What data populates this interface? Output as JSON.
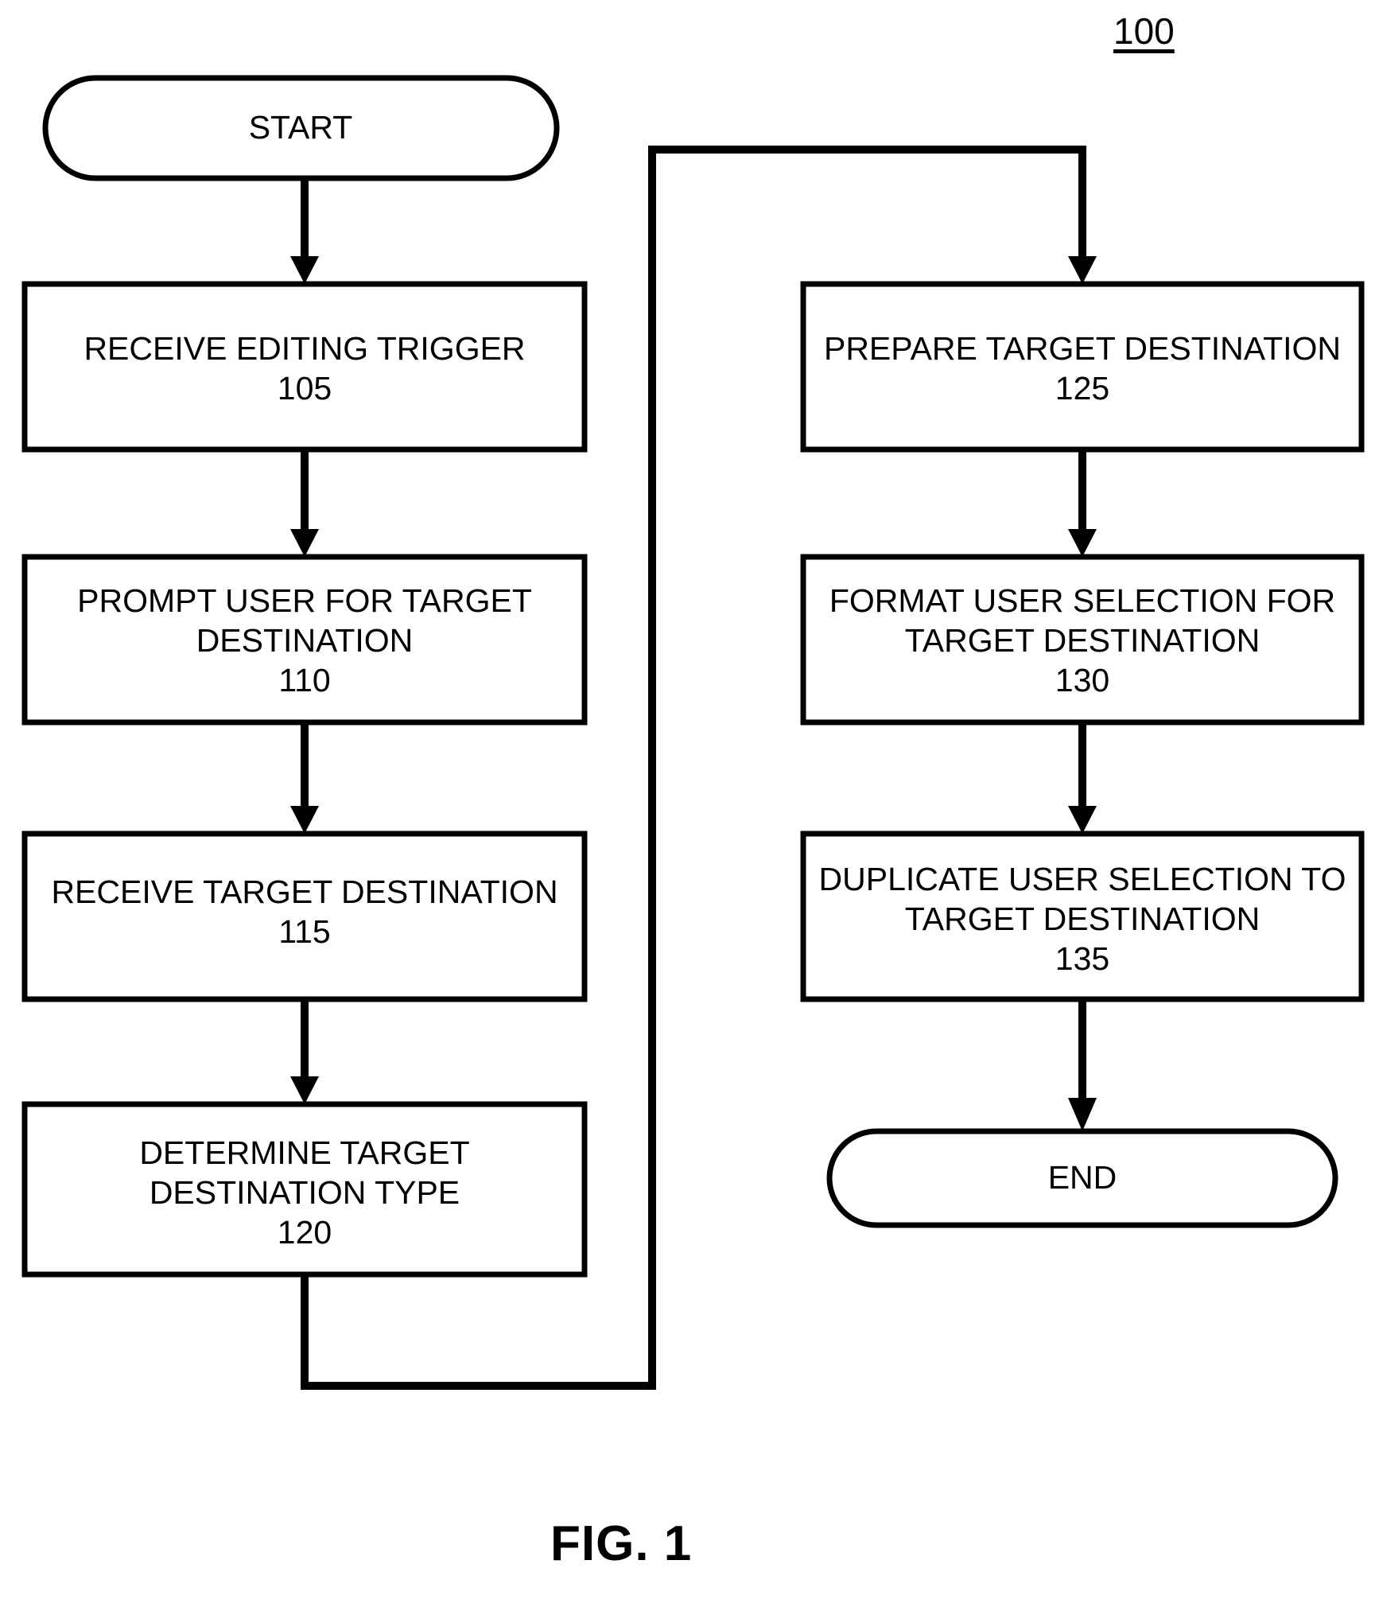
{
  "figure": {
    "reference_numeral": "100",
    "caption": "FIG. 1",
    "diagram_type": "flowchart"
  },
  "nodes": {
    "start": {
      "shape": "stadium",
      "label": "START"
    },
    "step105": {
      "shape": "process",
      "line1": "RECEIVE EDITING TRIGGER",
      "line2": "",
      "number": "105"
    },
    "step110": {
      "shape": "process",
      "line1": "PROMPT USER FOR TARGET",
      "line2": "DESTINATION",
      "number": "110"
    },
    "step115": {
      "shape": "process",
      "line1": "RECEIVE TARGET DESTINATION",
      "line2": "",
      "number": "115"
    },
    "step120": {
      "shape": "process",
      "line1": "DETERMINE TARGET",
      "line2": "DESTINATION TYPE",
      "number": "120"
    },
    "step125": {
      "shape": "process",
      "line1": "PREPARE TARGET DESTINATION",
      "line2": "",
      "number": "125"
    },
    "step130": {
      "shape": "process",
      "line1": "FORMAT USER SELECTION FOR",
      "line2": "TARGET DESTINATION",
      "number": "130"
    },
    "step135": {
      "shape": "process",
      "line1": "DUPLICATE USER SELECTION TO",
      "line2": "TARGET DESTINATION",
      "number": "135"
    },
    "end": {
      "shape": "stadium",
      "label": "END"
    }
  },
  "edges": [
    {
      "from": "start",
      "to": "step105",
      "style": "straight-down-arrow"
    },
    {
      "from": "step105",
      "to": "step110",
      "style": "straight-down-arrow"
    },
    {
      "from": "step110",
      "to": "step115",
      "style": "straight-down-arrow"
    },
    {
      "from": "step115",
      "to": "step120",
      "style": "straight-down-arrow"
    },
    {
      "from": "step120",
      "to": "step125",
      "style": "orthogonal-routed-arrow"
    },
    {
      "from": "step125",
      "to": "step130",
      "style": "straight-down-arrow"
    },
    {
      "from": "step130",
      "to": "step135",
      "style": "straight-down-arrow"
    },
    {
      "from": "step135",
      "to": "end",
      "style": "straight-down-arrow"
    }
  ],
  "colors": {
    "stroke": "#000000",
    "fill": "#ffffff",
    "background": "#ffffff"
  }
}
